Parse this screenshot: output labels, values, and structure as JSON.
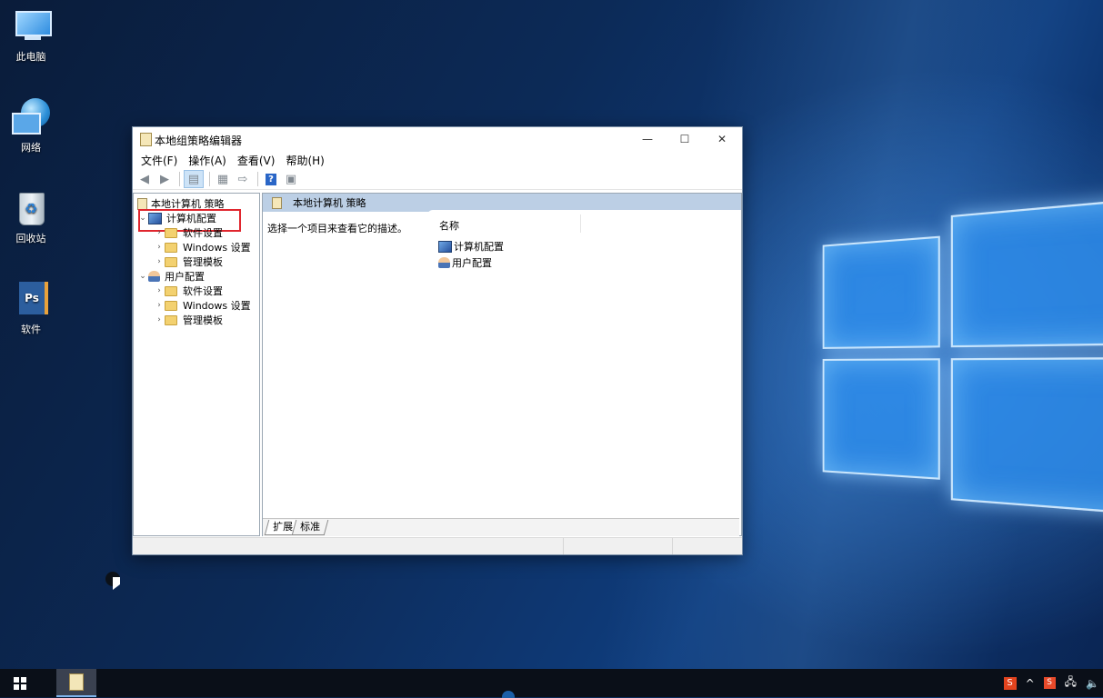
{
  "desktop": {
    "icons": [
      {
        "label": "此电脑",
        "icon": "this-pc-icon"
      },
      {
        "label": "网络",
        "icon": "network-icon"
      },
      {
        "label": "回收站",
        "icon": "recycle-bin-icon"
      },
      {
        "label": "软件",
        "icon": "software-folder-icon"
      }
    ]
  },
  "window": {
    "title": "本地组策略编辑器",
    "controls": {
      "minimize": "—",
      "maximize": "☐",
      "close": "✕"
    },
    "menu": [
      "文件(F)",
      "操作(A)",
      "查看(V)",
      "帮助(H)"
    ],
    "toolbar_icons": [
      "back-icon",
      "forward-icon",
      "show-hide-tree-icon",
      "properties-icon",
      "export-list-icon",
      "help-icon",
      "show-action-pane-icon"
    ],
    "tree": {
      "root": "本地计算机 策略",
      "computer_config": "计算机配置",
      "computer_children": [
        "软件设置",
        "Windows 设置",
        "管理模板"
      ],
      "user_config": "用户配置",
      "user_children": [
        "软件设置",
        "Windows 设置",
        "管理模板"
      ]
    },
    "right_pane": {
      "header": "本地计算机 策略",
      "description": "选择一个项目来查看它的描述。",
      "column_name": "名称",
      "items": [
        "计算机配置",
        "用户配置"
      ],
      "tabs": [
        "扩展",
        "标准"
      ]
    },
    "highlight_color": "#e0262e"
  },
  "taskbar": {
    "tray": {
      "ime": "S",
      "up_arrow": "^",
      "network": "🖧",
      "volume": "🔈"
    }
  }
}
